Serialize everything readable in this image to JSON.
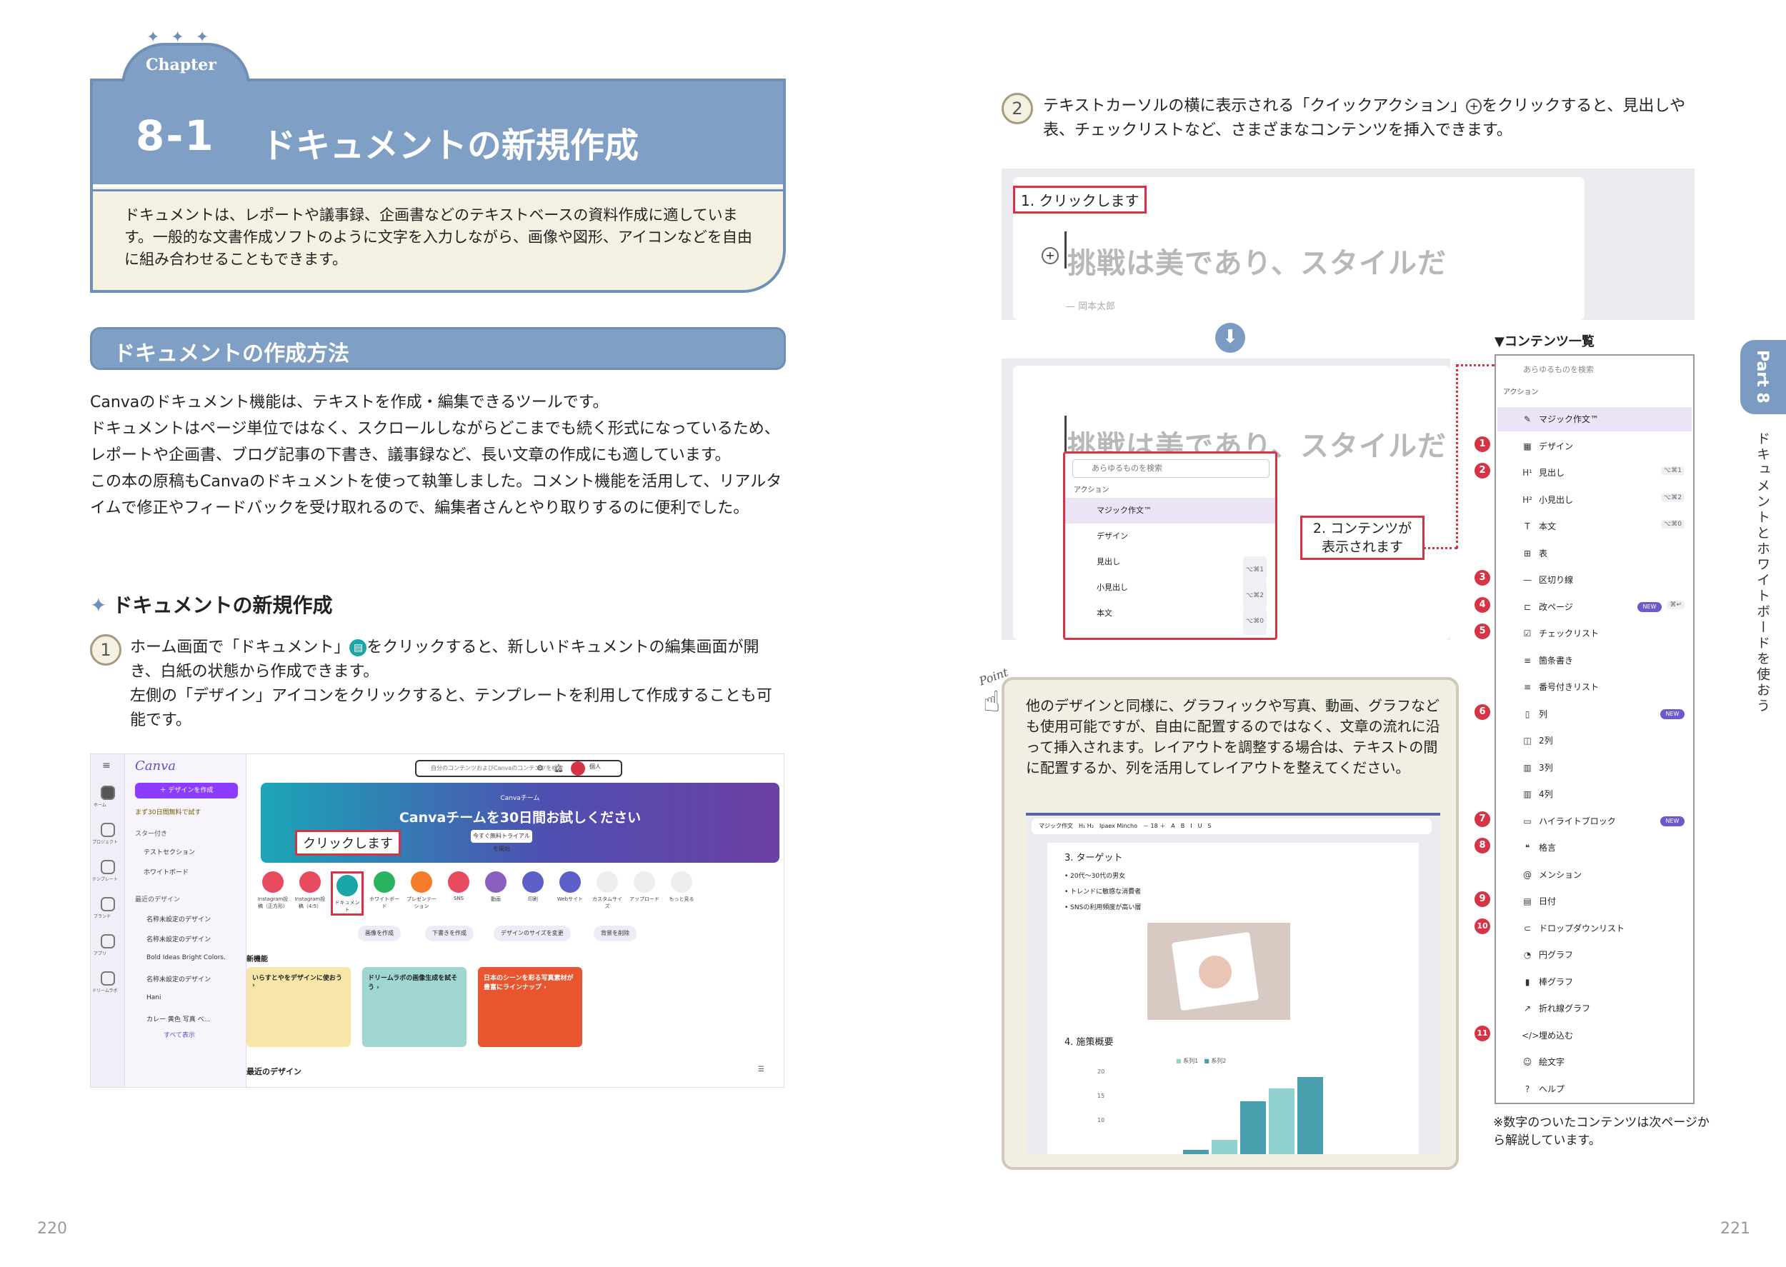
{
  "page_left": {
    "page_number": "220",
    "chapter": {
      "tab_label": "Chapter",
      "number": "8-1",
      "title": "ドキュメントの新規作成",
      "intro": "ドキュメントは、レポートや議事録、企画書などのテキストベースの資料作成に適しています。一般的な文書作成ソフトのように文字を入力しながら、画像や図形、アイコンなどを自由に組み合わせることもできます。"
    },
    "section_heading": "ドキュメントの作成方法",
    "body_paragraphs": [
      "Canvaのドキュメント機能は、テキストを作成・編集できるツールです。",
      "ドキュメントはページ単位ではなく、スクロールしながらどこまでも続く形式になっているため、レポートや企画書、ブログ記事の下書き、議事録など、長い文章の作成にも適しています。",
      "この本の原稿もCanvaのドキュメントを使って執筆しました。コメント機能を活用して、リアルタイムで修正やフィードバックを受け取れるので、編集者さんとやり取りするのに便利でした。"
    ],
    "sub_heading": "ドキュメントの新規作成",
    "step1": {
      "number": "1",
      "text_a": "ホーム画面で「ドキュメント」",
      "text_b": "をクリックすると、新しいドキュメントの編集画面が開き、白紙の状態から作成できます。",
      "text_c": "左側の「デザイン」アイコンをクリックすると、テンプレートを利用して作成することも可能です。"
    },
    "screenshot": {
      "logo": "Canva",
      "search_placeholder": "自分のコンテンツおよびCanvaのコンテンツを検索",
      "create_button": "＋ デザインを作成",
      "trial_note": "まず30日間無料で試す",
      "starred_label": "スター付き",
      "starred_items": [
        "テストセクション",
        "ホワイトボード"
      ],
      "recent_label": "最近のデザイン",
      "recent_items": [
        "名称未設定のデザイン",
        "名称未設定のデザイン",
        "Bold Ideas Bright Colors.",
        "名称未設定のデザイン",
        "Hani",
        "カレー 黄色 写真 ベ..."
      ],
      "show_all": "すべて表示",
      "rail_labels": [
        "ホーム",
        "プロジェクト",
        "テンプレート",
        "ブランド",
        "アプリ",
        "ドリームラボ"
      ],
      "hero_small": "Canvaチーム",
      "hero_title": "Canvaチームを30日間お試しください",
      "hero_button": "今すぐ無料トライアルを開始",
      "tools": [
        "Instagram投稿（正方形）",
        "Instagram投稿（4:5）",
        "ドキュメント",
        "ホワイトボード",
        "プレゼンテーション",
        "SNS",
        "動画",
        "印刷",
        "Webサイト",
        "カスタムサイズ",
        "アップロード",
        "もっと見る"
      ],
      "chips": [
        "画像を作成",
        "下書きを作成",
        "デザインのサイズを変更",
        "背景を削除"
      ],
      "new_features": "新機能",
      "cards": [
        "いらすとやをデザインに使おう ›",
        "ドリームラボの画像生成を試そう ›",
        "日本のシーンを彩る写真素材が豊富にラインナップ ›"
      ],
      "recent_designs": "最近のデザイン",
      "user": "個人",
      "callout": "クリックします"
    }
  },
  "page_right": {
    "page_number": "221",
    "step2": {
      "number": "2",
      "text_a": "テキストカーソルの横に表示される「クイックアクション」",
      "text_b": "をクリックすると、見出しや表、チェックリストなど、さまざまなコンテンツを挿入できます。"
    },
    "shot_top": {
      "callout": "1. クリックします",
      "doc_text": "挑戦は美であり、スタイルだ",
      "author": "— 岡本太郎"
    },
    "shot_bottom": {
      "doc_text": "挑戦は美であり、スタイルだ",
      "search": "あらゆるものを検索",
      "section": "アクション",
      "rows": [
        "マジック作文™",
        "デザイン",
        "見出し",
        "小見出し",
        "本文"
      ],
      "shortcuts": [
        "⌥⌘1",
        "⌥⌘2",
        "⌥⌘0"
      ],
      "callout": "2. コンテンツが\n表示されます"
    },
    "content_list": {
      "title": "▼コンテンツ一覧",
      "search": "あらゆるものを検索",
      "section": "アクション",
      "items": [
        {
          "label": "マジック作文™",
          "badge": "",
          "icon": "✎",
          "key": "",
          "new": false
        },
        {
          "label": "デザイン",
          "badge": "1",
          "icon": "▦",
          "key": "",
          "new": false
        },
        {
          "label": "見出し",
          "badge": "2",
          "icon": "H¹",
          "key": "⌥⌘1",
          "new": false
        },
        {
          "label": "小見出し",
          "badge": "",
          "icon": "H²",
          "key": "⌥⌘2",
          "new": false
        },
        {
          "label": "本文",
          "badge": "",
          "icon": "T",
          "key": "⌥⌘0",
          "new": false
        },
        {
          "label": "表",
          "badge": "",
          "icon": "⊞",
          "key": "",
          "new": false
        },
        {
          "label": "区切り線",
          "badge": "3",
          "icon": "—",
          "key": "",
          "new": false
        },
        {
          "label": "改ページ",
          "badge": "4",
          "icon": "⊏",
          "key": "⌘↵",
          "new": true
        },
        {
          "label": "チェックリスト",
          "badge": "5",
          "icon": "☑",
          "key": "",
          "new": false
        },
        {
          "label": "箇条書き",
          "badge": "",
          "icon": "≡",
          "key": "",
          "new": false
        },
        {
          "label": "番号付きリスト",
          "badge": "",
          "icon": "≡",
          "key": "",
          "new": false
        },
        {
          "label": "列",
          "badge": "6",
          "icon": "▯",
          "key": "",
          "new": true
        },
        {
          "label": "2列",
          "badge": "",
          "icon": "◫",
          "key": "",
          "new": false
        },
        {
          "label": "3列",
          "badge": "",
          "icon": "▥",
          "key": "",
          "new": false
        },
        {
          "label": "4列",
          "badge": "",
          "icon": "▥",
          "key": "",
          "new": false
        },
        {
          "label": "ハイライトブロック",
          "badge": "7",
          "icon": "▭",
          "key": "",
          "new": true
        },
        {
          "label": "格言",
          "badge": "8",
          "icon": "❝",
          "key": "",
          "new": false
        },
        {
          "label": "メンション",
          "badge": "",
          "icon": "@",
          "key": "",
          "new": false
        },
        {
          "label": "日付",
          "badge": "9",
          "icon": "▤",
          "key": "",
          "new": false
        },
        {
          "label": "ドロップダウンリスト",
          "badge": "10",
          "icon": "⊂",
          "key": "",
          "new": false
        },
        {
          "label": "円グラフ",
          "badge": "",
          "icon": "◔",
          "key": "",
          "new": false
        },
        {
          "label": "棒グラフ",
          "badge": "",
          "icon": "▮",
          "key": "",
          "new": false
        },
        {
          "label": "折れ線グラフ",
          "badge": "",
          "icon": "↗",
          "key": "",
          "new": false
        },
        {
          "label": "埋め込む",
          "badge": "11",
          "icon": "</>",
          "key": "",
          "new": false
        },
        {
          "label": "絵文字",
          "badge": "",
          "icon": "☺",
          "key": "",
          "new": false
        },
        {
          "label": "ヘルプ",
          "badge": "",
          "icon": "?",
          "key": "",
          "new": false
        }
      ],
      "new_label": "NEW",
      "note": "※数字のついたコンテンツは次ページから解説しています。"
    },
    "part_tab": "Part 8",
    "vertical_title": "ドキュメントとホワイトボードを使おう",
    "point": {
      "label": "Point",
      "text": "他のデザインと同様に、グラフィックや写真、動画、グラフなども使用可能ですが、自由に配置するのではなく、文章の流れに沿って挿入されます。レイアウトを調整する場合は、テキストの間に配置するか、列を活用してレイアウトを整えてください。",
      "doc": {
        "toolbar": "マジック作文",
        "font": "Ipaex Mincho",
        "font_size": "18",
        "heading3": "3. ターゲット",
        "bullets": [
          "20代〜30代の男女",
          "トレンドに敏感な消費者",
          "SNSの利用頻度が高い層"
        ],
        "heading4": "4. 施策概要",
        "legend": [
          "系列1",
          "系列2"
        ],
        "yticks": [
          "20",
          "15",
          "10"
        ]
      }
    }
  }
}
